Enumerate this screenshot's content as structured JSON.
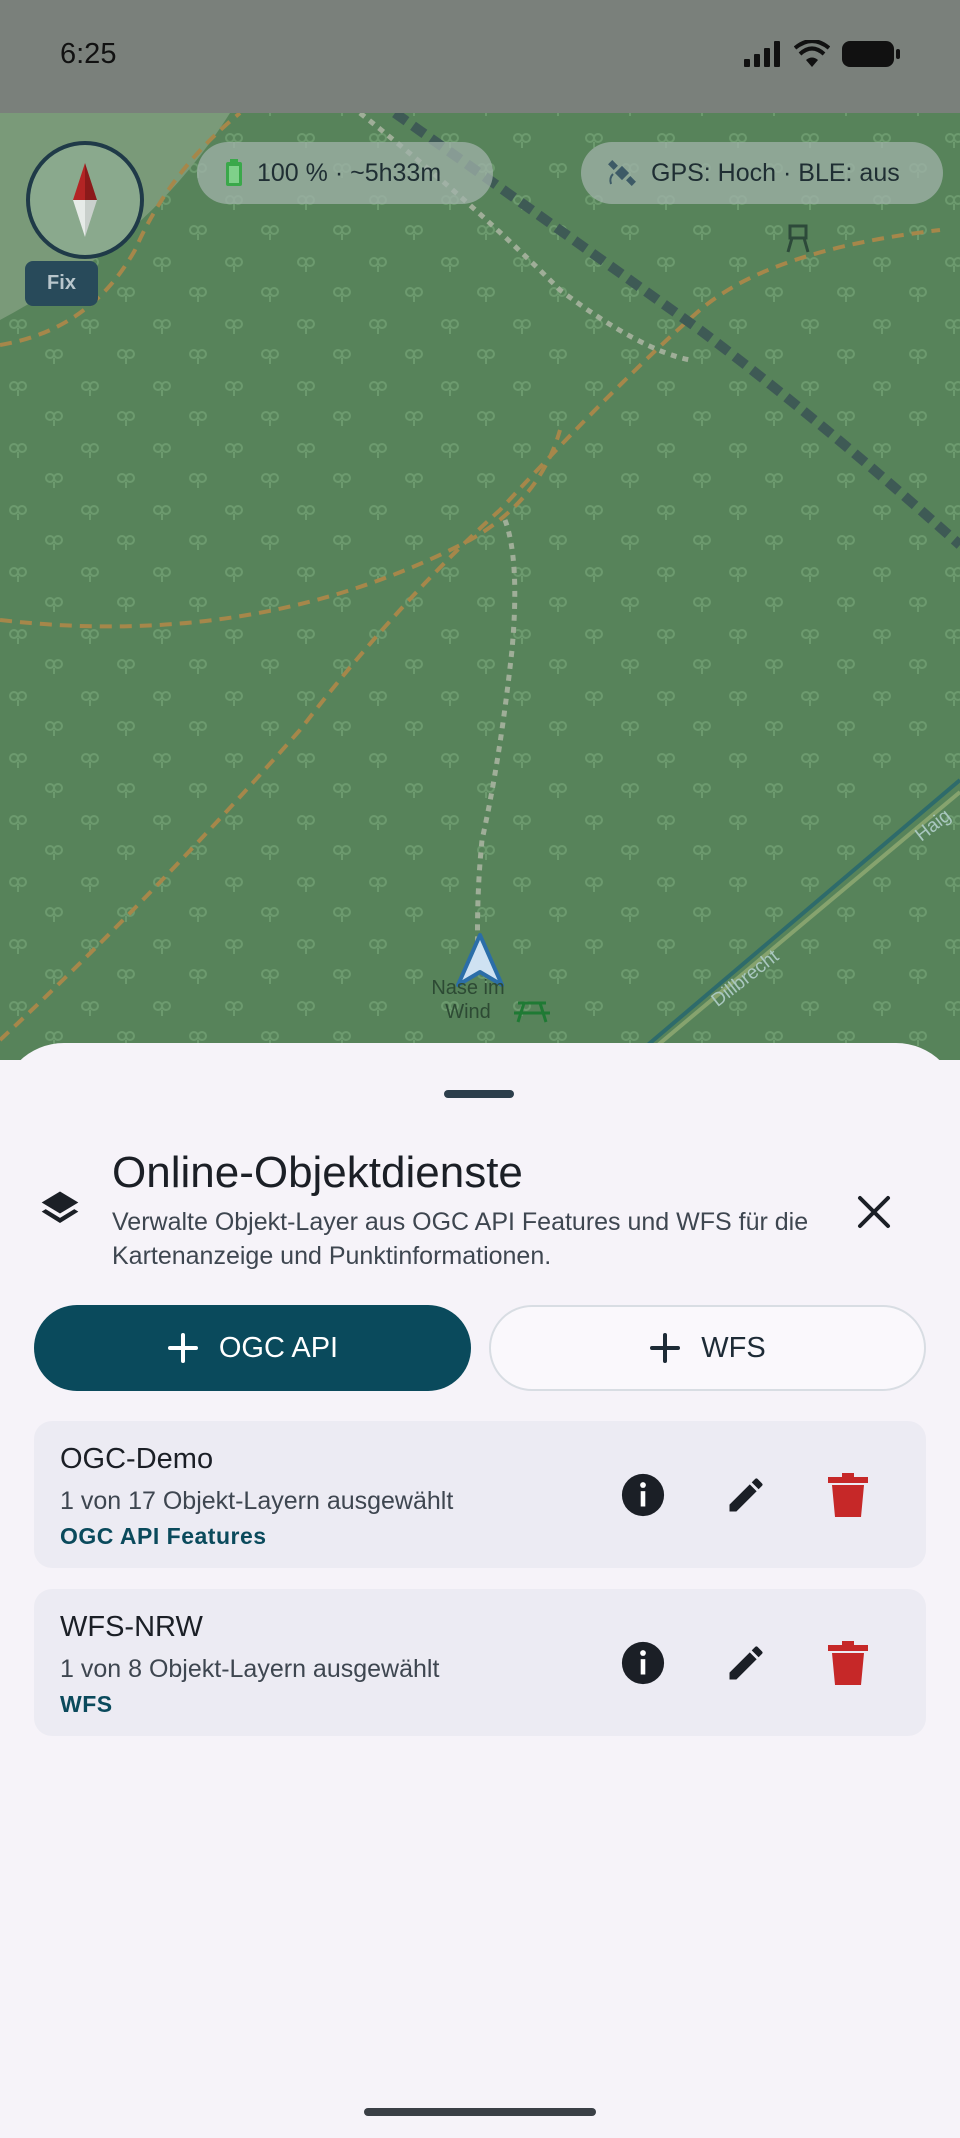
{
  "status_bar": {
    "time": "6:25"
  },
  "map": {
    "fix_label": "Fix",
    "battery_text": "100 % · ~5h33m",
    "gps_text": "GPS: Hoch · BLE: aus",
    "poi_label": "Nase im\nWind",
    "road_label_1": "Dillbrecht",
    "road_label_2": "Haig",
    "colors": {
      "forest": "#57835a",
      "path": "#a6874a",
      "rail": "#3e5a55"
    }
  },
  "sheet": {
    "title": "Online-Objektdienste",
    "description": "Verwalte Objekt-Layer aus OGC API Features und WFS für die Kartenanzeige und Punktinformationen.",
    "add_ogc_label": "OGC API",
    "add_wfs_label": "WFS",
    "services": [
      {
        "name": "OGC-Demo",
        "summary": "1 von 17 Objekt-Layern ausgewählt",
        "type": "OGC API Features"
      },
      {
        "name": "WFS-NRW",
        "summary": "1 von 8 Objekt-Layern ausgewählt",
        "type": "WFS"
      }
    ],
    "colors": {
      "primary": "#0a4a5c",
      "delete": "#c62828"
    }
  }
}
